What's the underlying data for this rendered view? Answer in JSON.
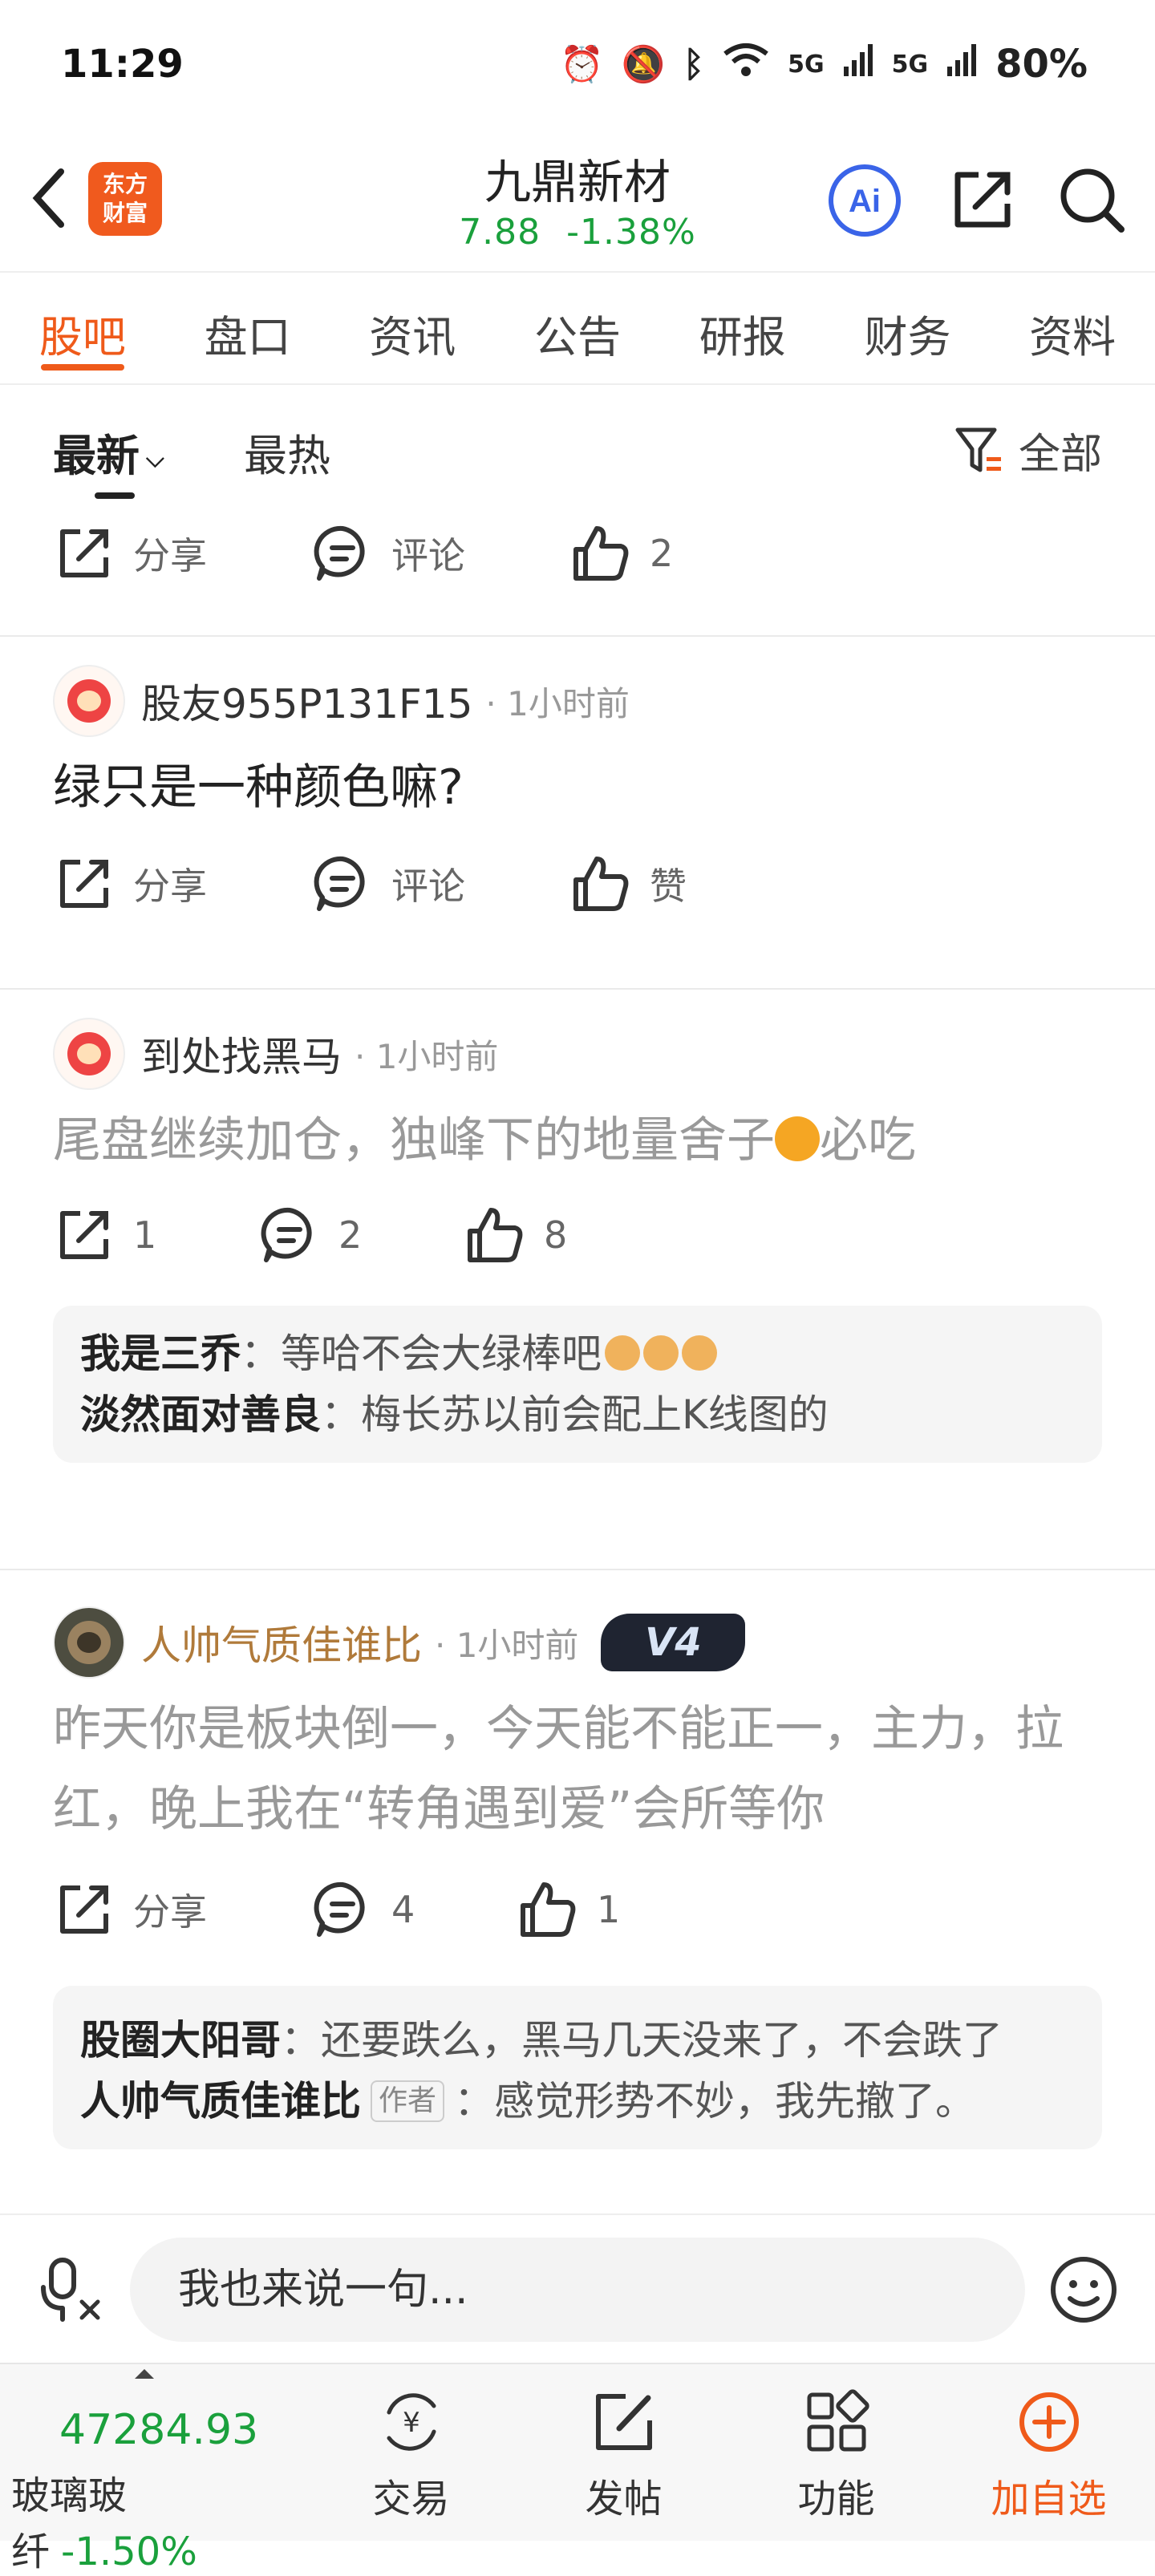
{
  "status_bar": {
    "time": "11:29",
    "battery": "80%",
    "network": "5G",
    "icons": [
      "alarm-icon",
      "mute-icon",
      "bluetooth-icon",
      "wifi-icon",
      "signal-icon",
      "signal-icon"
    ]
  },
  "header": {
    "logo_line1": "东方",
    "logo_line2": "财富",
    "stock_name": "九鼎新材",
    "price": "7.88",
    "change": "-1.38%",
    "ai_label": "Ai",
    "colors": {
      "down": "#1aa03c",
      "brand": "#f05a1e",
      "ai": "#3a64e8"
    }
  },
  "tabs": [
    {
      "label": "股吧",
      "active": true
    },
    {
      "label": "盘口"
    },
    {
      "label": "资讯"
    },
    {
      "label": "公告"
    },
    {
      "label": "研报"
    },
    {
      "label": "财务"
    },
    {
      "label": "资料"
    }
  ],
  "sort": {
    "latest": "最新",
    "hot": "最热",
    "filter": "全部"
  },
  "posts": [
    {
      "share": "分享",
      "comment": "评论",
      "like": "2"
    },
    {
      "user": "股友955P131F15",
      "time": "1小时前",
      "text": "绿只是一种颜色嘛?",
      "share": "分享",
      "comment": "评论",
      "like": "赞"
    },
    {
      "user": "到处找黑马",
      "time": "1小时前",
      "text_before": "尾盘继续加仓，独峰下的地量舍子",
      "text_after": "必吃",
      "share": "1",
      "comment": "2",
      "like": "8",
      "comments": [
        {
          "name": "我是三乔",
          "text": "：等哈不会大绿棒吧"
        },
        {
          "name": "淡然面对善良",
          "text": "：梅长苏以前会配上K线图的"
        }
      ]
    },
    {
      "user": "人帅气质佳谁比",
      "time": "1小时前",
      "badge": "V4",
      "text": "昨天你是板块倒一，今天能不能正一，主力，拉红，晚上我在“转角遇到爱”会所等你",
      "share": "分享",
      "comment": "4",
      "like": "1",
      "comments": [
        {
          "name": "股圈大阳哥",
          "text": "：还要跌么，黑马几天没来了，不会跌了"
        },
        {
          "name": "人帅气质佳谁比",
          "tag": "作者",
          "text": "：感觉形势不妙，我先撤了。"
        }
      ]
    }
  ],
  "composer": {
    "placeholder": "我也来说一句..."
  },
  "bottom_nav": {
    "index_value": "47284.93",
    "index_name": "玻璃玻纤",
    "index_change": "-1.50%",
    "items": [
      {
        "label": "交易",
        "icon": "yuan-cycle-icon"
      },
      {
        "label": "发帖",
        "icon": "edit-icon"
      },
      {
        "label": "功能",
        "icon": "grid-icon"
      },
      {
        "label": "加自选",
        "icon": "plus-circle-icon"
      }
    ]
  }
}
